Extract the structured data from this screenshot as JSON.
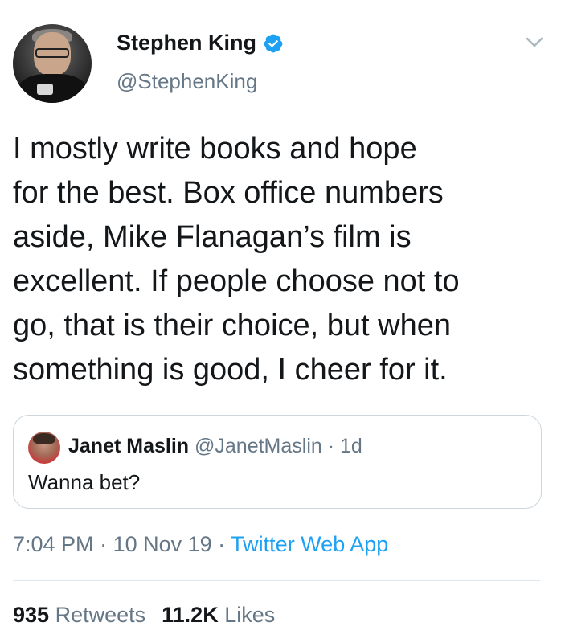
{
  "author": {
    "name": "Stephen King",
    "handle": "@StephenKing",
    "verified": true,
    "avatar_icon": "profile-photo"
  },
  "tweet": {
    "text": "I mostly write books and hope\nfor the best. Box office numbers\naside, Mike Flanagan’s film is\nexcellent. If people choose not to\ngo, that is their choice, but when\nsomething is good, I cheer for it."
  },
  "quoted_tweet": {
    "name": "Janet Maslin",
    "handle": "@JanetMaslin",
    "separator": " · ",
    "age": "1d",
    "text": "Wanna bet?"
  },
  "meta": {
    "time": "7:04 PM",
    "separator": " · ",
    "date": "10 Nov 19",
    "source": "Twitter Web App"
  },
  "stats": {
    "retweets_count": "935",
    "retweets_label": "Retweets",
    "likes_count": "11.2K",
    "likes_label": "Likes"
  },
  "colors": {
    "accent": "#1da1f2",
    "secondary_text": "#657786",
    "primary_text": "#14171a",
    "border": "#ccd6dd"
  }
}
